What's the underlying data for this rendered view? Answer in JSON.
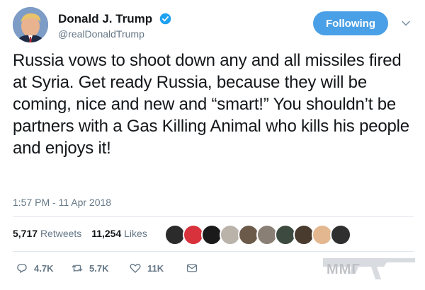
{
  "header": {
    "display_name": "Donald J. Trump",
    "handle": "@realDonaldTrump",
    "follow_label": "Following"
  },
  "tweet": {
    "text": "Russia vows to shoot down any and all missiles fired at Syria. Get ready Russia, because they will be coming, nice and new and “smart!” You shouldn’t be partners with a Gas Killing Animal who kills his people and enjoys it!",
    "timestamp": "1:57 PM - 11 Apr 2018"
  },
  "stats": {
    "retweets_count": "5,717",
    "retweets_label": "Retweets",
    "likes_count": "11,254",
    "likes_label": "Likes"
  },
  "actions": {
    "reply_count": "4.7K",
    "retweet_count": "5.7K",
    "like_count": "11K"
  },
  "watermark": {
    "text": "MMГ"
  },
  "colors": {
    "accent": "#4aa0e6",
    "muted": "#657786",
    "text": "#14171a",
    "divider": "#e1e8ed"
  }
}
